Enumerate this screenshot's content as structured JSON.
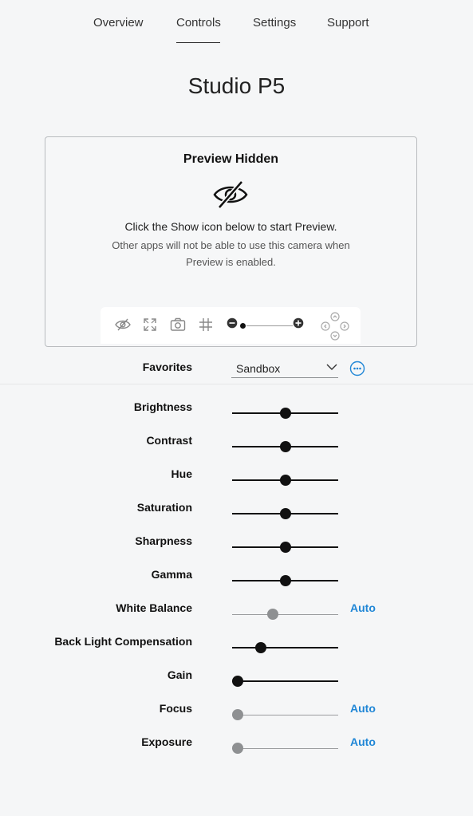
{
  "nav": {
    "tabs": [
      {
        "label": "Overview"
      },
      {
        "label": "Controls",
        "active": true
      },
      {
        "label": "Settings"
      },
      {
        "label": "Support"
      }
    ]
  },
  "device_title": "Studio P5",
  "preview": {
    "heading": "Preview Hidden",
    "instruction": "Click the Show icon below to start Preview.",
    "note": "Other apps will not be able to use this camera when Preview is enabled.",
    "toolbar_icons": [
      "eye-slash-icon",
      "fullscreen-icon",
      "camera-snapshot-icon",
      "grid-icon",
      "zoom-out-icon",
      "zoom-in-icon",
      "pan-tilt-icon"
    ],
    "zoom_level": 0
  },
  "favorites": {
    "label": "Favorites",
    "selected": "Sandbox",
    "more_icon": "more-icon"
  },
  "controls": [
    {
      "label": "Brightness",
      "value": 0.5,
      "auto": ""
    },
    {
      "label": "Contrast",
      "value": 0.5,
      "auto": ""
    },
    {
      "label": "Hue",
      "value": 0.5,
      "auto": ""
    },
    {
      "label": "Saturation",
      "value": 0.5,
      "auto": ""
    },
    {
      "label": "Sharpness",
      "value": 0.5,
      "auto": ""
    },
    {
      "label": "Gamma",
      "value": 0.5,
      "auto": ""
    },
    {
      "label": "White Balance",
      "value": 0.38,
      "auto": "Auto",
      "disabled": true
    },
    {
      "label": "Back Light Compensation",
      "value": 0.27,
      "auto": ""
    },
    {
      "label": "Gain",
      "value": 0.05,
      "auto": ""
    },
    {
      "label": "Focus",
      "value": 0.05,
      "auto": "Auto",
      "disabled": true
    },
    {
      "label": "Exposure",
      "value": 0.05,
      "auto": "Auto",
      "disabled": true
    }
  ],
  "colors": {
    "accent": "#1f86d6",
    "thumb": "#111111",
    "thumb_disabled": "#8e9092"
  }
}
